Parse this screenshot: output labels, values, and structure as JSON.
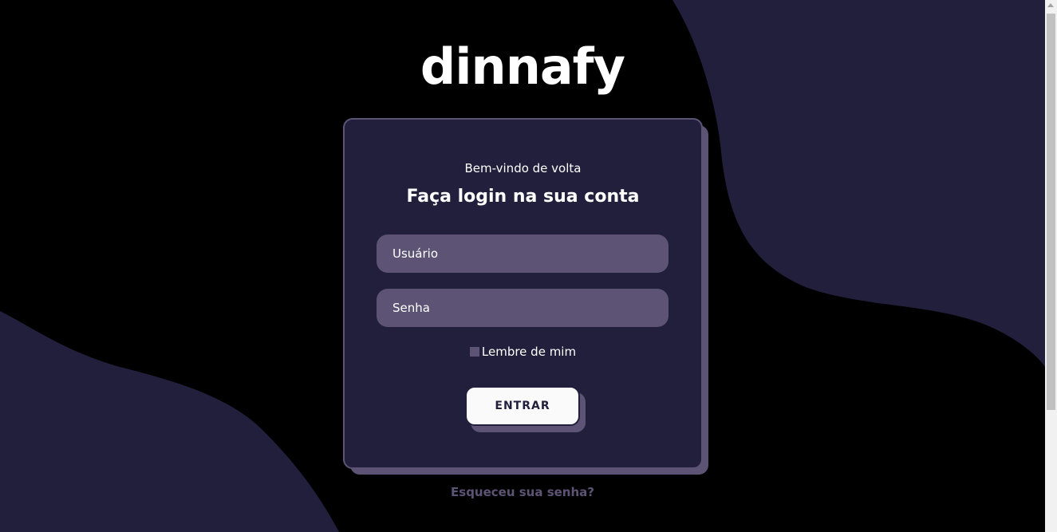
{
  "brand": {
    "logo_text": "dinnafy"
  },
  "login": {
    "welcome": "Bem-vindo de volta",
    "heading": "Faça login na sua conta",
    "username_placeholder": "Usuário",
    "password_placeholder": "Senha",
    "remember_label": "Lembre de mim",
    "submit_label": "ENTRAR",
    "forgot_label": "Esqueceu sua senha?"
  },
  "colors": {
    "background": "#000000",
    "blob": "#221f3c",
    "accent": "#5d5475",
    "text": "#ffffff",
    "button_bg": "#fafafa"
  }
}
